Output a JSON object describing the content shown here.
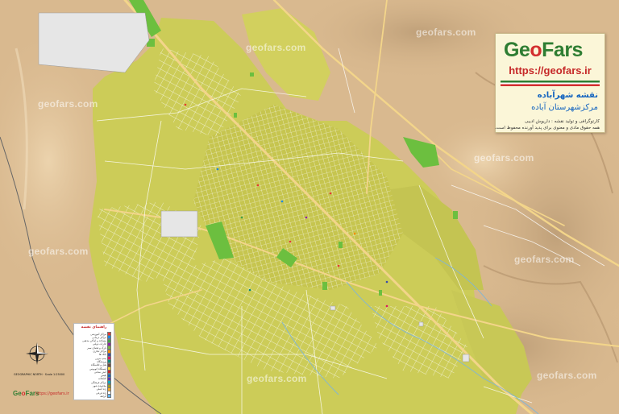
{
  "brand": {
    "name_part1": "Ge",
    "name_o": "o",
    "name_part2": "Fars",
    "url": "https://geofars.ir"
  },
  "map_title": {
    "line1": "نقشه شهرآباده",
    "line2": "مرکزشهرستان آباده"
  },
  "credits": {
    "line1": "کارتوگرافی و تولید نقشه : داریوش ادیبی",
    "line2": "همه حقوق مادی و معنوی برای پدید آورنده محفوظ است."
  },
  "watermark_text": "geofars.com",
  "legend": {
    "title": "راهنمای نقشه",
    "items": [
      {
        "label": "مراکز آموزشی",
        "color": "#e53935"
      },
      {
        "label": "مراکز درمانی",
        "color": "#1e88e5"
      },
      {
        "label": "مساجد و اماکن مذهبی",
        "color": "#43a047"
      },
      {
        "label": "ادارات دولتی",
        "color": "#8e24aa"
      },
      {
        "label": "پارک و فضای سبز",
        "color": "#7cb342"
      },
      {
        "label": "مراکز تجاری",
        "color": "#fb8c00"
      },
      {
        "label": "بانک ها",
        "color": "#3949ab"
      },
      {
        "label": "پمپ بنزین",
        "color": "#d81b60"
      },
      {
        "label": "ورزشگاه",
        "color": "#00897b"
      },
      {
        "label": "هتل و اقامتگاه",
        "color": "#6d4c41"
      },
      {
        "label": "ایستگاه اتوبوس",
        "color": "#fdd835"
      },
      {
        "label": "آتش نشانی",
        "color": "#c62828"
      },
      {
        "label": "پلیس",
        "color": "#1565c0"
      },
      {
        "label": "کتابخانه",
        "color": "#5e35b1"
      },
      {
        "label": "مراکز فرهنگی",
        "color": "#00acc1"
      },
      {
        "label": "محدوده شهر",
        "color": "#9e9d24"
      },
      {
        "label": "راه اصلی",
        "color": "#f9a825"
      },
      {
        "label": "راه فرعی",
        "color": "#ffffff"
      },
      {
        "label": "آبراهه",
        "color": "#64b5f6"
      }
    ]
  },
  "scale_info": "GEOGRAPHIC NORTH  ·  Scale 1:25000",
  "colors": {
    "terrain": "#d9b98f",
    "urban": "#cccc58",
    "park": "#6cbf3f",
    "road_major": "#f3d58a",
    "road_minor": "#ffffff",
    "water": "#7fb5d8",
    "brand_green": "#2e7d32",
    "brand_red": "#d32f2f"
  },
  "icons": {
    "logo_pin": "map-pin-icon",
    "compass": "compass-rose-icon"
  }
}
